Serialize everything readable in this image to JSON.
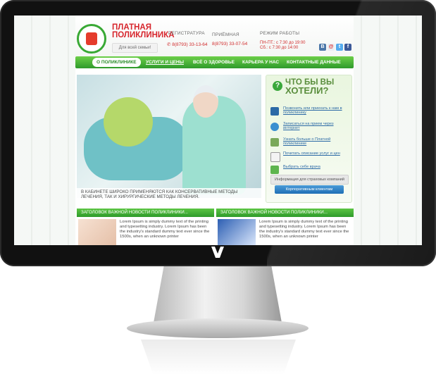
{
  "header": {
    "brand_line1": "ПЛАТНАЯ",
    "brand_line2": "ПОЛИКЛИНИКА",
    "tagline": "Для всей семьи!",
    "top_links": [
      "РЕГИСТРАТУРА",
      "ПРИЁМНАЯ",
      "РЕЖИМ РАБОТЫ"
    ],
    "phones": [
      "8(8793) 33-13-64",
      "8(8793) 33-07-54"
    ],
    "hours": [
      "ПН-ПТ.: с 7:30 до 19:00",
      "Сб.: с 7:30 до 14:00"
    ],
    "social_icons": [
      "vk-icon",
      "gmail-icon",
      "twitter-icon",
      "facebook-icon"
    ]
  },
  "nav": {
    "items": [
      "О ПОЛИКЛИНИКЕ",
      "УСЛУГИ И ЦЕНЫ",
      "ВСЁ О ЗДОРОВЬЕ",
      "КАРЬЕРА У НАС",
      "КОНТАКТНЫЕ ДАННЫЕ"
    ]
  },
  "hero": {
    "caption": "В КАБИНЕТЕ ШИРОКО ПРИМЕНЯЮТСЯ КАК КОНСЕРВАТИВНЫЕ МЕТОДЫ ЛЕЧЕНИЯ, ТАК И ХИРУРГИЧЕСКИЕ МЕТОДЫ ЛЕЧЕНИЯ."
  },
  "panel": {
    "title_line1": "ЧТО БЫ ВЫ",
    "title_line2": "ХОТЕЛИ?",
    "items": [
      {
        "text": "Позвонить или приехать к нам в поликлинику",
        "icon": "phone-icon"
      },
      {
        "text": "Записаться на прием через интернет",
        "icon": "globe-icon"
      },
      {
        "text": "Узнать больше о Платной поликлинике",
        "icon": "building-icon"
      },
      {
        "text": "Почитать описание услуг и цен",
        "icon": "document-icon"
      },
      {
        "text": "Выбрать себе врача",
        "icon": "doctor-icon"
      }
    ],
    "insurance_button": "Информация для страховых компаний",
    "corporate_button": "Корпоративным клиентам"
  },
  "news": [
    {
      "heading": "ЗАГОЛОВОК ВАЖНОЙ НОВОСТИ ПОЛИКЛИНИКИ...",
      "text": "Lorem Ipsum is simply dummy text of the printing and typesetting industry. Lorem Ipsum has been the industry's standard dummy text ever since the 1500s, when an unknown printer"
    },
    {
      "heading": "ЗАГОЛОВОК ВАЖНОЙ НОВОСТИ ПОЛИКЛИНИКИ...",
      "text": "Lorem Ipsum is simply dummy text of the printing and typesetting industry. Lorem Ipsum has been the industry's standard dummy text ever since the 1500s, when an unknown printer"
    }
  ],
  "colors": {
    "accent_green": "#3aa83b",
    "brand_red": "#d7262d",
    "link_blue": "#2c6aa6",
    "button_blue": "#1e6fb5"
  }
}
